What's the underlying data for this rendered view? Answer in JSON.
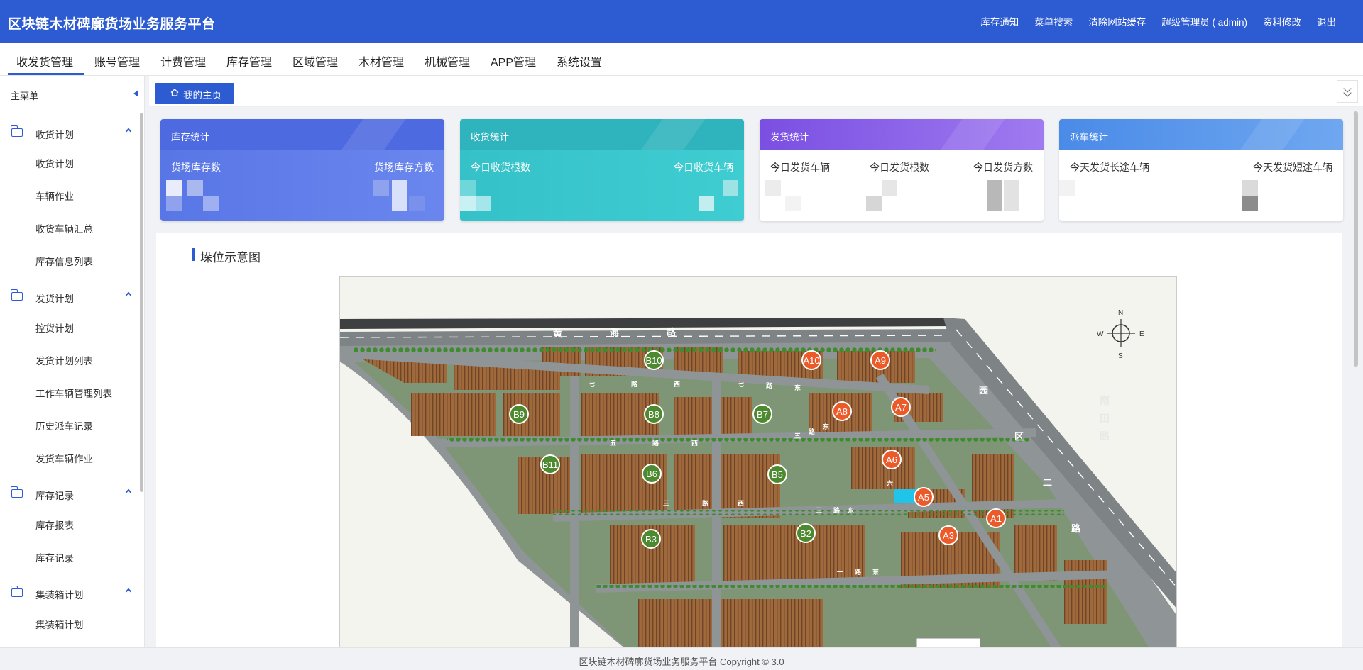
{
  "app": {
    "title": "区块链木材碑廓货场业务服务平台"
  },
  "top_links": [
    "库存通知",
    "菜单搜索",
    "清除网站缓存",
    "超级管理员 ( admin)",
    "资料修改",
    "退出"
  ],
  "menu": [
    "收发货管理",
    "账号管理",
    "计费管理",
    "库存管理",
    "区域管理",
    "木材管理",
    "机械管理",
    "APP管理",
    "系统设置"
  ],
  "sidebar": {
    "header": "主菜单",
    "groups": [
      {
        "label": "收货计划",
        "items": [
          "收货计划",
          "车辆作业",
          "收货车辆汇总",
          "库存信息列表"
        ]
      },
      {
        "label": "发货计划",
        "items": [
          "控货计划",
          "发货计划列表",
          "工作车辆管理列表",
          "历史派车记录",
          "发货车辆作业"
        ]
      },
      {
        "label": "库存记录",
        "items": [
          "库存报表",
          "库存记录"
        ]
      },
      {
        "label": "集装箱计划",
        "items": [
          "集装箱计划"
        ]
      }
    ]
  },
  "tabs": {
    "home": "我的主页"
  },
  "cards": [
    {
      "title": "库存统计",
      "labels": [
        "货场库存数",
        "货场库存方数"
      ],
      "color": "#4e6ae0"
    },
    {
      "title": "收货统计",
      "labels": [
        "今日收货根数",
        "今日收货车辆"
      ],
      "color": "#2fb3bd"
    },
    {
      "title": "发货统计",
      "labels": [
        "今日发货车辆",
        "今日发货根数",
        "今日发货方数"
      ],
      "color": "#7a4fe2"
    },
    {
      "title": "派车统计",
      "labels": [
        "今天发货长途车辆",
        "今天发货短途车辆"
      ],
      "color": "#4a8be8"
    }
  ],
  "panel": {
    "title": "垛位示意图"
  },
  "map": {
    "roads": [
      "黄",
      "海",
      "路",
      "七",
      "路",
      "西",
      "七",
      "路",
      "东",
      "五",
      "路",
      "西",
      "五",
      "路",
      "东",
      "三",
      "路",
      "西",
      "三",
      "路",
      "东",
      "一",
      "路",
      "东",
      "园",
      "区",
      "二",
      "路",
      "六",
      "路",
      "南",
      "田",
      "路"
    ],
    "compass": [
      "N",
      "S",
      "W",
      "E"
    ],
    "zones_b": [
      "B10",
      "B9",
      "B8",
      "B7",
      "B11",
      "B6",
      "B5",
      "B3",
      "B2"
    ],
    "zones_a": [
      "A10",
      "A9",
      "A8",
      "A7",
      "A6",
      "A5",
      "A1",
      "A3"
    ]
  },
  "footer": "区块链木材碑廓货场业务服务平台 Copyright © 3.0"
}
